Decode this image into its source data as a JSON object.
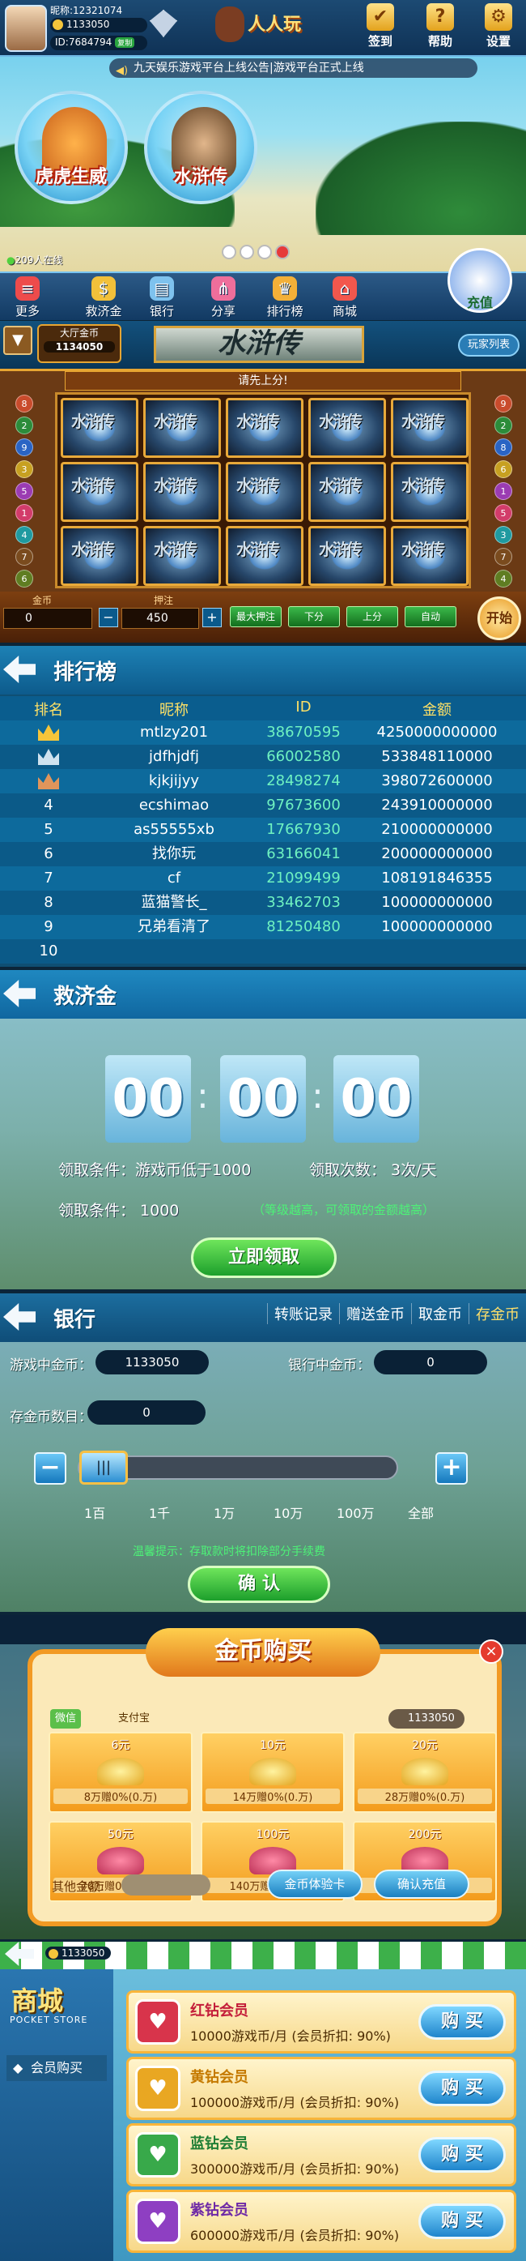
{
  "lobby": {
    "nickname": "昵称:12321074",
    "coins": "1133050",
    "id": "ID:7684794",
    "copy_label": "复制",
    "logo": "人人玩",
    "actions": [
      {
        "label": "签到",
        "icon": "calendar-icon",
        "glyph": "✔"
      },
      {
        "label": "帮助",
        "icon": "help-icon",
        "glyph": "?"
      },
      {
        "label": "设置",
        "icon": "gear-icon",
        "glyph": "⚙"
      }
    ],
    "marquee": "九天娱乐游戏平台上线公告|游戏平台正式上线",
    "games": [
      {
        "label": "虎虎生威",
        "icon": "tiger-icon"
      },
      {
        "label": "水浒传",
        "icon": "hero-icon"
      }
    ],
    "online": "209人在线",
    "nav": [
      {
        "label": "更多",
        "icon": "more-icon"
      },
      {
        "label": "救济金",
        "icon": "relief-icon"
      },
      {
        "label": "银行",
        "icon": "bank-icon"
      },
      {
        "label": "分享",
        "icon": "share-icon"
      },
      {
        "label": "排行榜",
        "icon": "ranking-icon"
      },
      {
        "label": "商城",
        "icon": "shop-icon"
      }
    ],
    "recharge_label": "充值"
  },
  "slot": {
    "gold_label": "大厅金币",
    "gold_value": "1134050",
    "title": "水浒传",
    "rules_button": "玩家列表",
    "banner": "请先上分!",
    "cell_text": "水浒传",
    "left_lines": [
      "8",
      "2",
      "9",
      "3",
      "5",
      "1",
      "4",
      "7",
      "6"
    ],
    "right_lines": [
      "9",
      "2",
      "8",
      "6",
      "1",
      "5",
      "3",
      "7",
      "4"
    ],
    "gold_caption": "金币",
    "bet_caption": "押注",
    "gold_amount": "0",
    "bet_amount": "450",
    "minus": "−",
    "plus": "+",
    "buttons": [
      "最大押注",
      "下分",
      "上分",
      "自动"
    ],
    "start_label": "开始"
  },
  "ranking": {
    "title": "排行榜",
    "columns": [
      "排名",
      "昵称",
      "ID",
      "金额"
    ],
    "rows": [
      {
        "rank": "",
        "crown": "gold",
        "name": "mtlzy201",
        "id": "38670595",
        "amount": "4250000000000"
      },
      {
        "rank": "",
        "crown": "silver",
        "name": "jdfhjdfj",
        "id": "66002580",
        "amount": "533848110000"
      },
      {
        "rank": "",
        "crown": "bronze",
        "name": "kjkjijyy",
        "id": "28498274",
        "amount": "398072600000"
      },
      {
        "rank": "4",
        "crown": "",
        "name": "ecshimao",
        "id": "97673600",
        "amount": "243910000000"
      },
      {
        "rank": "5",
        "crown": "",
        "name": "as55555xb",
        "id": "17667930",
        "amount": "210000000000"
      },
      {
        "rank": "6",
        "crown": "",
        "name": "找你玩",
        "id": "63166041",
        "amount": "200000000000"
      },
      {
        "rank": "7",
        "crown": "",
        "name": "cf",
        "id": "21099499",
        "amount": "108191846355"
      },
      {
        "rank": "8",
        "crown": "",
        "name": "蓝猫警长_",
        "id": "33462703",
        "amount": "100000000000"
      },
      {
        "rank": "9",
        "crown": "",
        "name": "兄弟看清了",
        "id": "81250480",
        "amount": "100000000000"
      },
      {
        "rank": "10",
        "crown": "",
        "name": "",
        "id": "",
        "amount": ""
      }
    ]
  },
  "relief": {
    "title": "救济金",
    "timer": [
      "00",
      "00",
      "00"
    ],
    "cond1": "领取条件：游戏币低于1000",
    "count": "领取次数： 3次/天",
    "cond2": "领取条件： 1000",
    "note": "（等级越高，可领取的金额越高）",
    "button": "立即领取"
  },
  "bank": {
    "title": "银行",
    "tabs": [
      "转账记录",
      "赠送金币",
      "取金币",
      "存金币"
    ],
    "active_tab": 3,
    "game_coins_label": "游戏中金币：",
    "game_coins": "1133050",
    "bank_coins_label": "银行中金币：",
    "bank_coins": "0",
    "deposit_label": "存金币数目：",
    "deposit_value": "0",
    "minus": "−",
    "plus": "+",
    "slider_fraction": 0,
    "ticks": [
      "1百",
      "1千",
      "1万",
      "10万",
      "100万",
      "全部"
    ],
    "tip": "温馨提示：存取款时将扣除部分手续费",
    "confirm": "确 认"
  },
  "purchase": {
    "title": "金币购买",
    "pay_methods": [
      "微信",
      "支付宝"
    ],
    "coins": "1133050",
    "items": [
      {
        "price": "6元",
        "desc": "8万赠0%(0.万)",
        "kind": "coins"
      },
      {
        "price": "10元",
        "desc": "14万赠0%(0.万)",
        "kind": "coins"
      },
      {
        "price": "20元",
        "desc": "28万赠0%(0.万)",
        "kind": "coins"
      },
      {
        "price": "50元",
        "desc": "70万赠0%(0.万)",
        "kind": "bag"
      },
      {
        "price": "100元",
        "desc": "140万赠0%(0.万)",
        "kind": "bag"
      },
      {
        "price": "200元",
        "desc": "280万赠0%(0.万)",
        "kind": "bag"
      }
    ],
    "other_label": "其他金额:",
    "trial_button": "金币体验卡",
    "confirm_button": "确认充值",
    "close": "×"
  },
  "shop": {
    "coins": "1133050",
    "title": "商城",
    "subtitle": "POCKET STORE",
    "tab": "会员购买",
    "members": [
      {
        "name": "红钻会员",
        "desc": "10000游戏币/月 (会员折扣: 90%)",
        "color": "#d8344b",
        "name_color": "#c41e3a"
      },
      {
        "name": "黄钻会员",
        "desc": "100000游戏币/月 (会员折扣: 90%)",
        "color": "#e9a722",
        "name_color": "#c57a00"
      },
      {
        "name": "蓝钻会员",
        "desc": "300000游戏币/月 (会员折扣: 90%)",
        "color": "#38a94a",
        "name_color": "#1f7f35"
      },
      {
        "name": "紫钻会员",
        "desc": "600000游戏币/月 (会员折扣: 90%)",
        "color": "#8e3fc2",
        "name_color": "#6f2aa6"
      }
    ],
    "buy_label": "购 买"
  }
}
